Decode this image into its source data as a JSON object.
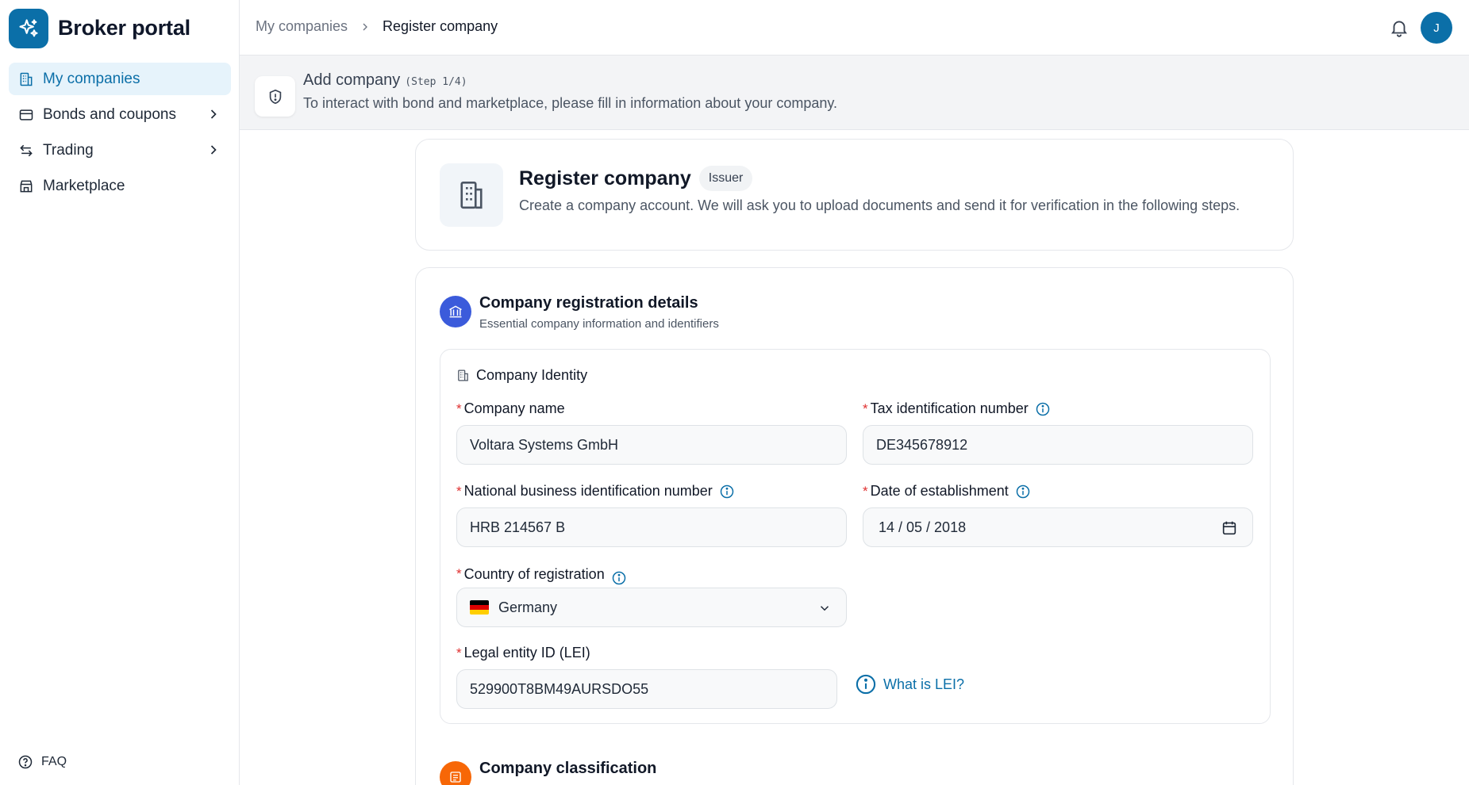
{
  "app": {
    "name": "Broker portal"
  },
  "sidebar": {
    "items": [
      {
        "label": "My companies",
        "icon": "building-icon",
        "active": true
      },
      {
        "label": "Bonds and coupons",
        "icon": "card-icon",
        "has_children": true
      },
      {
        "label": "Trading",
        "icon": "arrows-icon",
        "has_children": true
      },
      {
        "label": "Marketplace",
        "icon": "store-icon"
      }
    ],
    "faq_label": "FAQ"
  },
  "breadcrumb": {
    "parent": "My companies",
    "current": "Register company"
  },
  "header": {
    "avatar_initial": "J"
  },
  "banner": {
    "title": "Add company",
    "step": "(Step 1/4)",
    "description": "To interact with bond and marketplace, please fill in information about your company."
  },
  "page_header": {
    "title": "Register company",
    "badge": "Issuer",
    "description": "Create a company account. We will ask you to upload documents and send it for verification in the following steps."
  },
  "registration": {
    "title": "Company registration details",
    "subtitle": "Essential company information and identifiers",
    "identity_title": "Company Identity",
    "fields": {
      "company_name": {
        "label": "Company name",
        "value": "Voltara Systems GmbH"
      },
      "tax_id": {
        "label": "Tax identification number",
        "value": "DE345678912"
      },
      "national_id": {
        "label": "National business identification number",
        "value": "HRB 214567 B"
      },
      "date_established": {
        "label": "Date of establishment",
        "value": "14 / 05 / 2018"
      },
      "country": {
        "label": "Country of registration",
        "value": "Germany"
      },
      "lei": {
        "label": "Legal entity ID (LEI)",
        "value": "529900T8BM49AURSDO55"
      }
    },
    "lei_help": "What is LEI?"
  },
  "classification": {
    "title": "Company classification"
  },
  "colors": {
    "accent": "#0b6fa8",
    "required": "#e03131",
    "section_blue": "#3b5bdb",
    "section_orange": "#f76707"
  }
}
